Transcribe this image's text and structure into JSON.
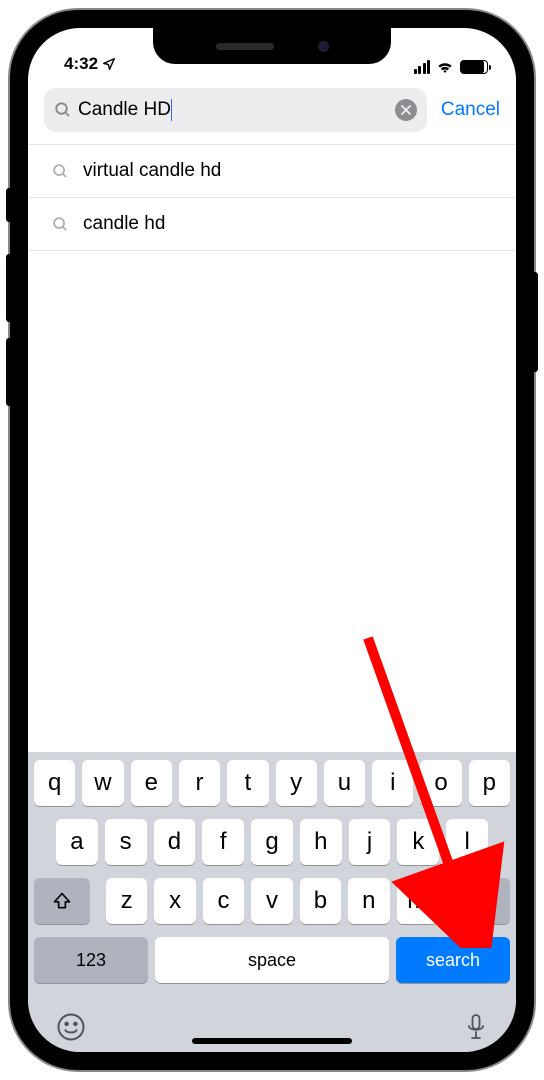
{
  "status": {
    "time": "4:32",
    "location_arrow": "➤"
  },
  "search": {
    "value": "Candle HD",
    "cancel_label": "Cancel"
  },
  "suggestions": [
    "virtual candle hd",
    "candle hd"
  ],
  "keyboard": {
    "row1": [
      "q",
      "w",
      "e",
      "r",
      "t",
      "y",
      "u",
      "i",
      "o",
      "p"
    ],
    "row2": [
      "a",
      "s",
      "d",
      "f",
      "g",
      "h",
      "j",
      "k",
      "l"
    ],
    "row3": [
      "z",
      "x",
      "c",
      "v",
      "b",
      "n",
      "m"
    ],
    "numbers_label": "123",
    "space_label": "space",
    "action_label": "search"
  }
}
